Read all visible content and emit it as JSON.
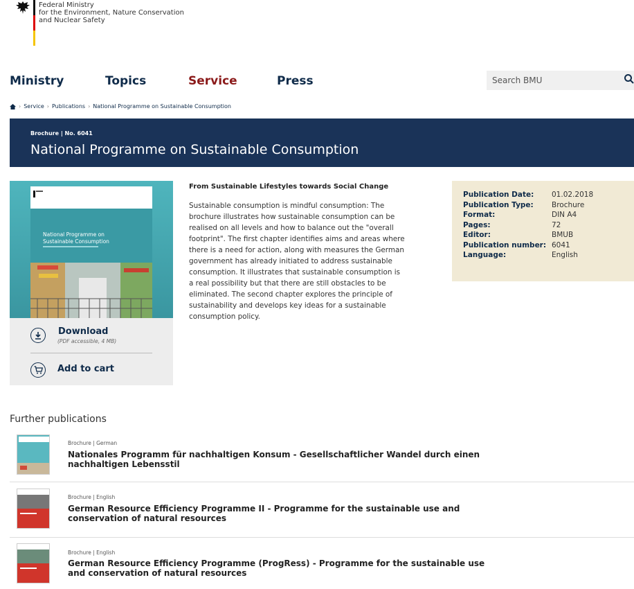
{
  "header": {
    "logo_lines": [
      "Federal Ministry",
      "for the Environment, Nature Conservation",
      "and Nuclear Safety"
    ]
  },
  "nav": {
    "items": [
      "Ministry",
      "Topics",
      "Service",
      "Press"
    ],
    "active": "Service"
  },
  "search": {
    "placeholder": "Search BMU"
  },
  "breadcrumb": [
    "Service",
    "Publications",
    "National Programme on Sustainable Consumption"
  ],
  "banner": {
    "meta": "Brochure | No. 6041",
    "title": "National Programme on Sustainable Consumption"
  },
  "actions": {
    "download_label": "Download",
    "download_sub": "(PDF accessible, 4 MB)",
    "cart_label": "Add to cart"
  },
  "description": {
    "heading": "From Sustainable Lifestyles towards Social Change",
    "lines": [
      "Sustainable consumption is mindful consumption: The",
      "brochure illustrates how sustainable consumption can be",
      "realised on all levels and how to balance out the \"overall",
      "footprint\". The first chapter identifies aims and areas where",
      "there is a need for action, along with measures the German",
      "government has already initiated to address sustainable",
      "consumption. It illustrates that sustainable consumption is",
      "a real possibility but that there are still obstacles to be",
      "eliminated. The second chapter explores the principle of",
      "sustainability and develops key ideas for a sustainable",
      "consumption policy."
    ]
  },
  "info": {
    "rows": [
      {
        "key": "Publication Date:",
        "value": "01.02.2018"
      },
      {
        "key": "Publication Type:",
        "value": "Brochure"
      },
      {
        "key": "Format:",
        "value": "DIN A4"
      },
      {
        "key": "Pages:",
        "value": "72"
      },
      {
        "key": "Editor:",
        "value": "BMUB"
      },
      {
        "key": "Publication number:",
        "value": "6041"
      },
      {
        "key": "Language:",
        "value": "English"
      }
    ]
  },
  "cover": {
    "title_lines": [
      "National Programme on",
      "Sustainable Consumption"
    ]
  },
  "further": {
    "title": "Further publications",
    "items": [
      {
        "meta": "Brochure | German",
        "title_lines": [
          "Nationales Programm für nachhaltigen Konsum - Gesellschaftlicher Wandel durch einen",
          "nachhaltigen Lebensstil"
        ]
      },
      {
        "meta": "Brochure | English",
        "title_lines": [
          "German Resource Efficiency Programme II - Programme for the sustainable use and",
          "conservation of natural resources"
        ]
      },
      {
        "meta": "Brochure | English",
        "title_lines": [
          "German Resource Efficiency Programme (ProgRess) - Programme for the sustainable use",
          "and conservation of natural resources"
        ]
      }
    ]
  },
  "colors": {
    "banner_bg": "#1a3358",
    "nav_active": "#8b1a1a",
    "info_bg": "#f1ead5",
    "cover_teal": "#5ab8c0"
  },
  "icons": [
    "eagle-logo-icon",
    "search-icon",
    "home-icon",
    "download-icon",
    "cart-icon"
  ]
}
